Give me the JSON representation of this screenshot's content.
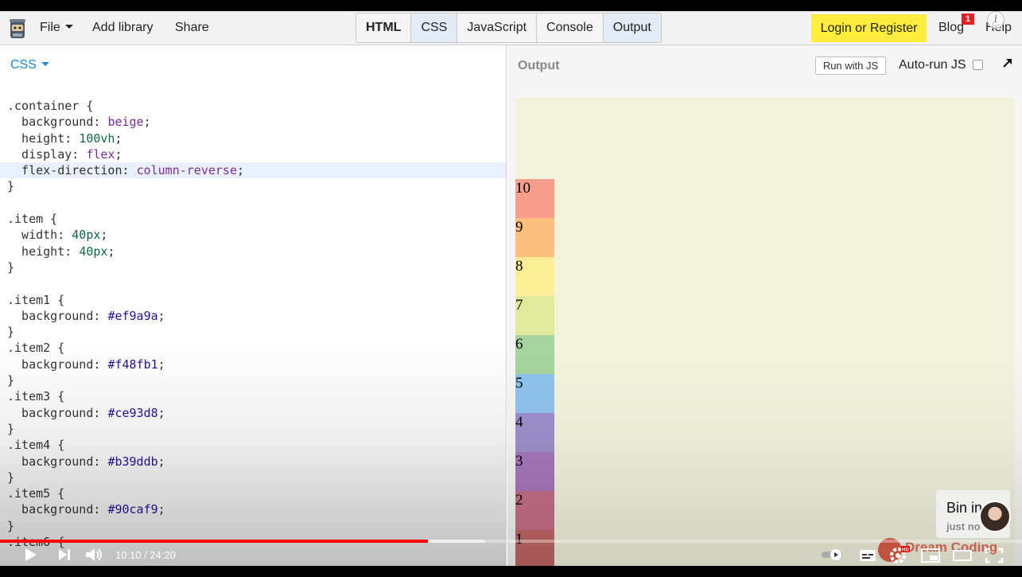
{
  "toolbar": {
    "menus": [
      {
        "label": "File",
        "has_caret": true
      },
      {
        "label": "Add library"
      },
      {
        "label": "Share"
      }
    ],
    "tabs": [
      {
        "label": "HTML",
        "bold": true,
        "active": false
      },
      {
        "label": "CSS",
        "active": true
      },
      {
        "label": "JavaScript",
        "active": false
      },
      {
        "label": "Console",
        "active": false
      },
      {
        "label": "Output",
        "active": true
      }
    ],
    "login_label": "Login or Register",
    "blog_label": "Blog",
    "blog_badge": "1",
    "help_label": "Help",
    "info_icon": "i"
  },
  "css_pane": {
    "title": "CSS",
    "highlighted_line": 4,
    "lines": [
      ".container {",
      "  background: beige;",
      "  height: 100vh;",
      "  display: flex;",
      "  flex-direction: column-reverse;",
      "}",
      "",
      ".item {",
      "  width: 40px;",
      "  height: 40px;",
      "}",
      "",
      ".item1 {",
      "  background: #ef9a9a;",
      "}",
      ".item2 {",
      "  background: #f48fb1;",
      "}",
      ".item3 {",
      "  background: #ce93d8;",
      "}",
      ".item4 {",
      "  background: #b39ddb;",
      "}",
      ".item5 {",
      "  background: #90caf9;",
      "}",
      ".item6 {"
    ]
  },
  "output_pane": {
    "title": "Output",
    "run_button": "Run with JS",
    "autorun_label": "Auto-run JS",
    "autorun_checked": false,
    "container_color": "#f2f2dd",
    "items": [
      {
        "label": "10",
        "color": "#f99e8c"
      },
      {
        "label": "9",
        "color": "#fcbf7c"
      },
      {
        "label": "8",
        "color": "#fbee96"
      },
      {
        "label": "7",
        "color": "#e1e99a"
      },
      {
        "label": "6",
        "color": "#a5d49e"
      },
      {
        "label": "5",
        "color": "#8ec3ee"
      },
      {
        "label": "4",
        "color": "#9d8fcc"
      },
      {
        "label": "3",
        "color": "#a777bb"
      },
      {
        "label": "2",
        "color": "#c56f88"
      },
      {
        "label": "1",
        "color": "#c16665"
      }
    ]
  },
  "video": {
    "time": "10:10 / 24:20",
    "progress": 0.419,
    "buffered": 0.475,
    "notification": {
      "title": "Bin in",
      "subtitle": "just no"
    },
    "watermark": "Dream Coding",
    "hd_badge": "HD",
    "icons": [
      "play-icon",
      "next-icon",
      "volume-icon",
      "autoplay-toggle-icon",
      "subtitles-icon",
      "settings-icon",
      "miniplayer-icon",
      "theater-icon",
      "fullscreen-icon"
    ]
  },
  "colors": {
    "accent_blue": "#1b8adb",
    "login_yellow": "#ffec3d",
    "progress_red": "#ff0000"
  }
}
